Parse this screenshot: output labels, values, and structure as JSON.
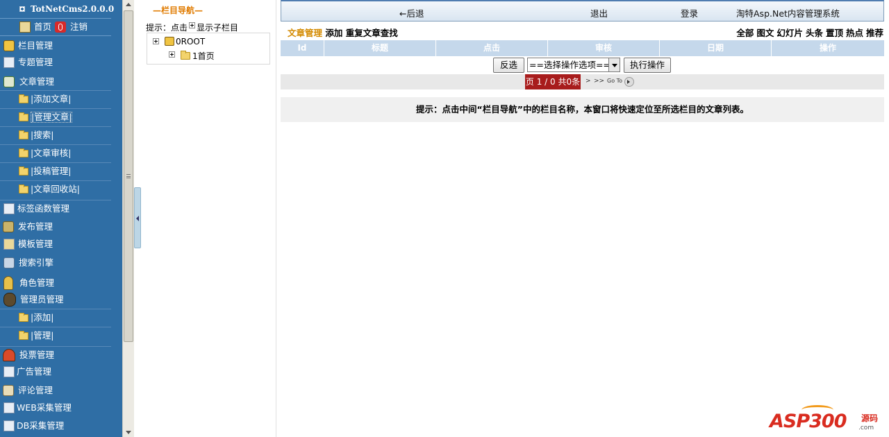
{
  "sidebar": {
    "title": "TotNetCms2.0.0.0",
    "home": "首页",
    "logout": "注销",
    "items": [
      {
        "label": "栏目管理",
        "icon": "column-icon"
      },
      {
        "label": "专题管理",
        "icon": "topic-icon"
      },
      {
        "label": "文章管理",
        "icon": "article-icon"
      },
      {
        "label": "标签函数管理",
        "icon": "tag-icon"
      },
      {
        "label": "发布管理",
        "icon": "publish-icon"
      },
      {
        "label": "模板管理",
        "icon": "template-icon"
      },
      {
        "label": "搜索引擎",
        "icon": "search-engine-icon"
      },
      {
        "label": "角色管理",
        "icon": "role-icon"
      },
      {
        "label": "管理员管理",
        "icon": "admin-icon"
      },
      {
        "label": "投票管理",
        "icon": "vote-icon"
      },
      {
        "label": "广告管理",
        "icon": "ad-icon"
      },
      {
        "label": "评论管理",
        "icon": "comment-icon"
      },
      {
        "label": "WEB采集管理",
        "icon": "web-collect-icon"
      },
      {
        "label": "DB采集管理",
        "icon": "db-collect-icon"
      }
    ],
    "article_sub": [
      "|添加文章|",
      "|管理文章|",
      "|搜索|",
      "|文章审核|",
      "|投稿管理|",
      "|文章回收站|"
    ],
    "admin_sub": [
      "|添加|",
      "|管理|"
    ]
  },
  "tree": {
    "title": "—栏目导航—",
    "hint_prefix": "提示：点击",
    "hint_suffix": "显示子栏目",
    "root": "0ROOT",
    "child": "1首页"
  },
  "topnav": {
    "back": "←后退",
    "exit": "退出",
    "login": "登录",
    "system": "淘特Asp.Net内容管理系统"
  },
  "toolbar": {
    "current": "文章管理",
    "add": "添加",
    "dup": "重复文章查找"
  },
  "filters": [
    "全部",
    "图文",
    "幻灯片",
    "头条",
    "置顶",
    "热点",
    "推荐"
  ],
  "table": {
    "headers": [
      "Id",
      "标题",
      "点击",
      "审核",
      "日期",
      "操作"
    ]
  },
  "actions": {
    "invert": "反选",
    "select": "==选择操作选项==",
    "exec": "执行操作"
  },
  "pager": {
    "page": "页 1 / 0 共0条",
    "next": ">",
    "last": ">>",
    "goto": "Go To"
  },
  "notice": "提示：点击中间“栏目导航”中的栏目名称，本窗口将快速定位至所选栏目的文章列表。",
  "watermark": {
    "brand": "ASP300",
    "side": "源码",
    "com": ".com"
  },
  "colors": {
    "sidebar_bg": "#2f6ea5",
    "accent_orange": "#e07b00",
    "pager_red": "#a81c1c",
    "table_head": "#c5d8eb"
  }
}
